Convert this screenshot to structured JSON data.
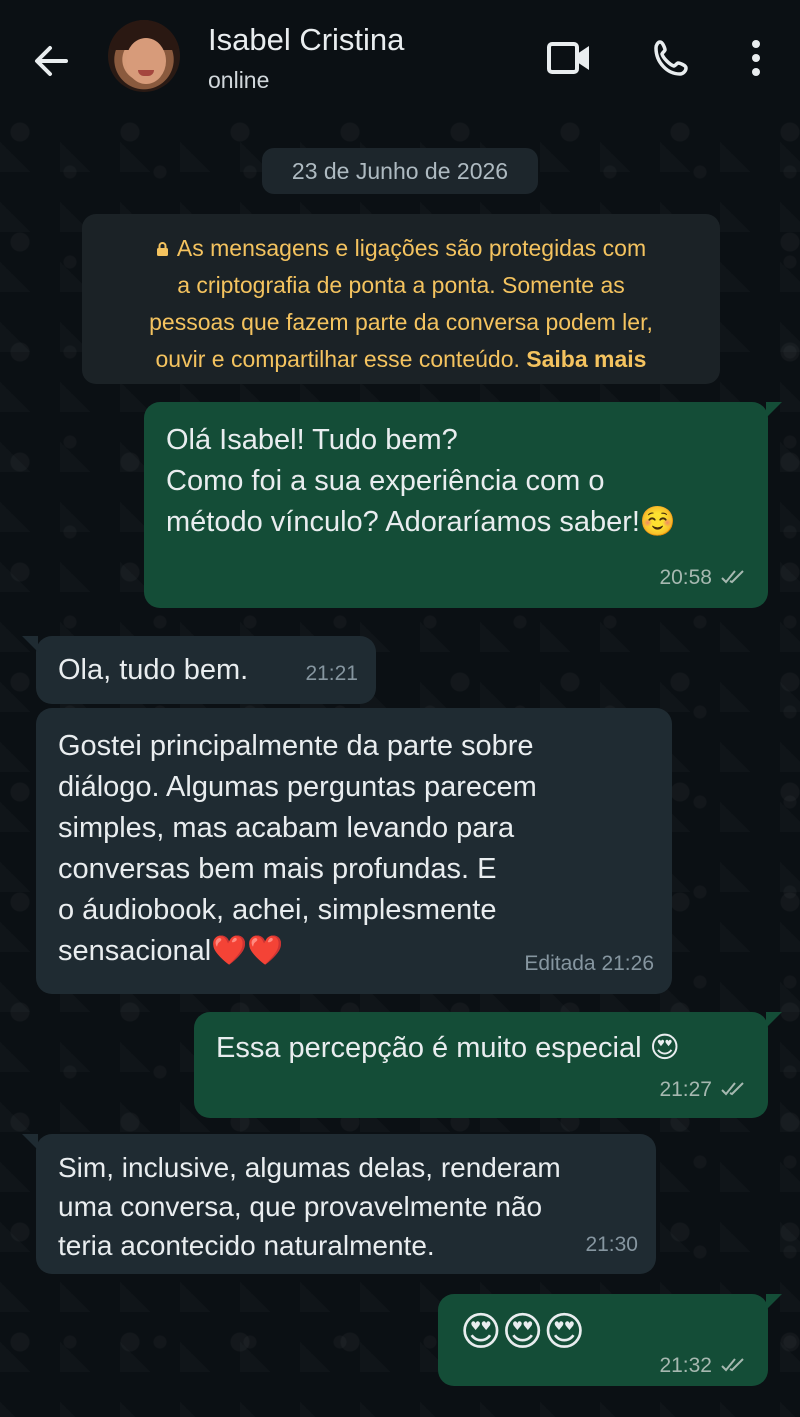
{
  "header": {
    "name": "Isabel Cristina",
    "status": "online",
    "icons": [
      "back-arrow-icon",
      "avatar",
      "video-call-icon",
      "phone-call-icon",
      "more-options-icon"
    ]
  },
  "date_chip": "23 de Junho de 2026",
  "encryption": {
    "lines": [
      "As mensagens e ligações são protegidas com",
      "a criptografia de ponta a ponta. Somente as",
      "pessoas que fazem parte da conversa podem ler,",
      "ouvir e compartilhar esse conteúdo."
    ],
    "link": "Saiba mais"
  },
  "messages": [
    {
      "direction": "out",
      "lines": [
        "Olá Isabel! Tudo bem?",
        "Como foi a sua experiência com o",
        "método vínculo? Adoraríamos saber!☺️"
      ],
      "time": "20:58",
      "read": true
    },
    {
      "direction": "in",
      "lines": [
        "Ola, tudo bem."
      ],
      "time": "21:21"
    },
    {
      "direction": "in",
      "lines": [
        "Gostei principalmente da parte sobre",
        "diálogo. Algumas perguntas parecem",
        "simples, mas acabam levando para",
        "conversas bem mais profundas. E",
        "o áudiobook, achei, simplesmente",
        "sensacional❤️❤️"
      ],
      "time": "Editada 21:26"
    },
    {
      "direction": "out",
      "lines": [
        "Essa percepção é muito especial 😍"
      ],
      "time": "21:27",
      "read": true
    },
    {
      "direction": "in",
      "lines": [
        "Sim, inclusive, algumas delas, renderam",
        "uma conversa, que provavelmente não",
        "teria acontecido naturalmente."
      ],
      "time": "21:30"
    },
    {
      "direction": "out",
      "lines": [
        "😍😍😍"
      ],
      "time": "21:32",
      "read": true
    }
  ],
  "colors": {
    "background": "#0b1014",
    "outgoing_bubble": "#144d37",
    "incoming_bubble": "#1f2b32",
    "encryption_text": "#f4c35f",
    "read_ticks": "#a6b8b0"
  }
}
